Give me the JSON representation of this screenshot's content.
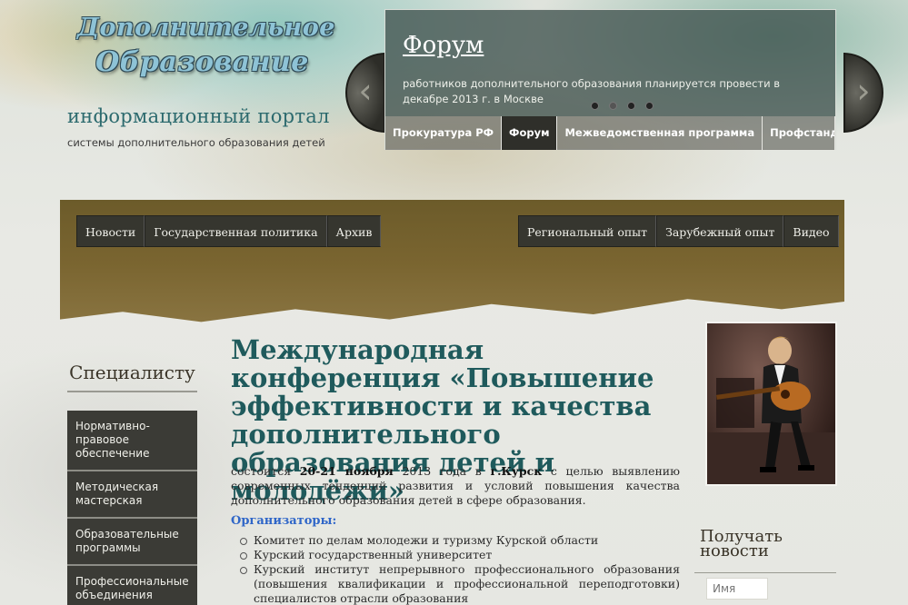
{
  "header": {
    "logo_line1": "Дополнительное",
    "logo_line2": "Образование",
    "portal_title": "информационный портал",
    "portal_subtitle": "системы дополнительного образования детей"
  },
  "slider": {
    "title": "Форум",
    "text": "работников дополнительного образования планируется провести в декабре 2013 г. в Москве",
    "dots_count": 4,
    "active_dot": 2,
    "prev_label": "‹",
    "next_label": "›",
    "tabs": [
      {
        "label": "Прокуратура РФ",
        "active": false
      },
      {
        "label": "Форум",
        "active": true
      },
      {
        "label": "Межведомственная программа",
        "active": false
      },
      {
        "label": "Профстандарт",
        "active": false
      }
    ]
  },
  "main_nav": {
    "left": [
      "Новости",
      "Государственная политика",
      "Архив"
    ],
    "right": [
      "Региональный опыт",
      "Зарубежный опыт",
      "Видео"
    ]
  },
  "sidebar": {
    "title": "Специалисту",
    "items": [
      "Нормативно-правовое обеспечение",
      "Методическая мастерская",
      "Образовательные программы",
      "Профессиональные объединения"
    ]
  },
  "article": {
    "title": "Международная конференция «Повышение эффективности и качества дополнительного образования детей и молодёжи»",
    "intro_pre": "состоится ",
    "intro_dates": "20-21 ноября",
    "intro_mid": " 2013 года в ",
    "intro_city": "г.Курск",
    "intro_post": " с целью выявлению современных тенденций развития и условий повышения качества дополнительного образования детей в сфере образования.",
    "organizers_label": "Организаторы:",
    "organizers": [
      "Комитет по делам молодежи и туризму Курской области",
      "Курский государственный университет",
      "Курский институт непрерывного профессионального образования (повышения квалификации и профессиональной переподготовки) специалистов отрасли образования"
    ]
  },
  "right_column": {
    "news_title": "Получать новости",
    "name_placeholder": "Имя"
  },
  "colors": {
    "accent_teal": "#1f5a5c",
    "nav_dark": "#36362f",
    "band_olive": "#7a6530",
    "organizers_blue": "#2f66c8"
  }
}
